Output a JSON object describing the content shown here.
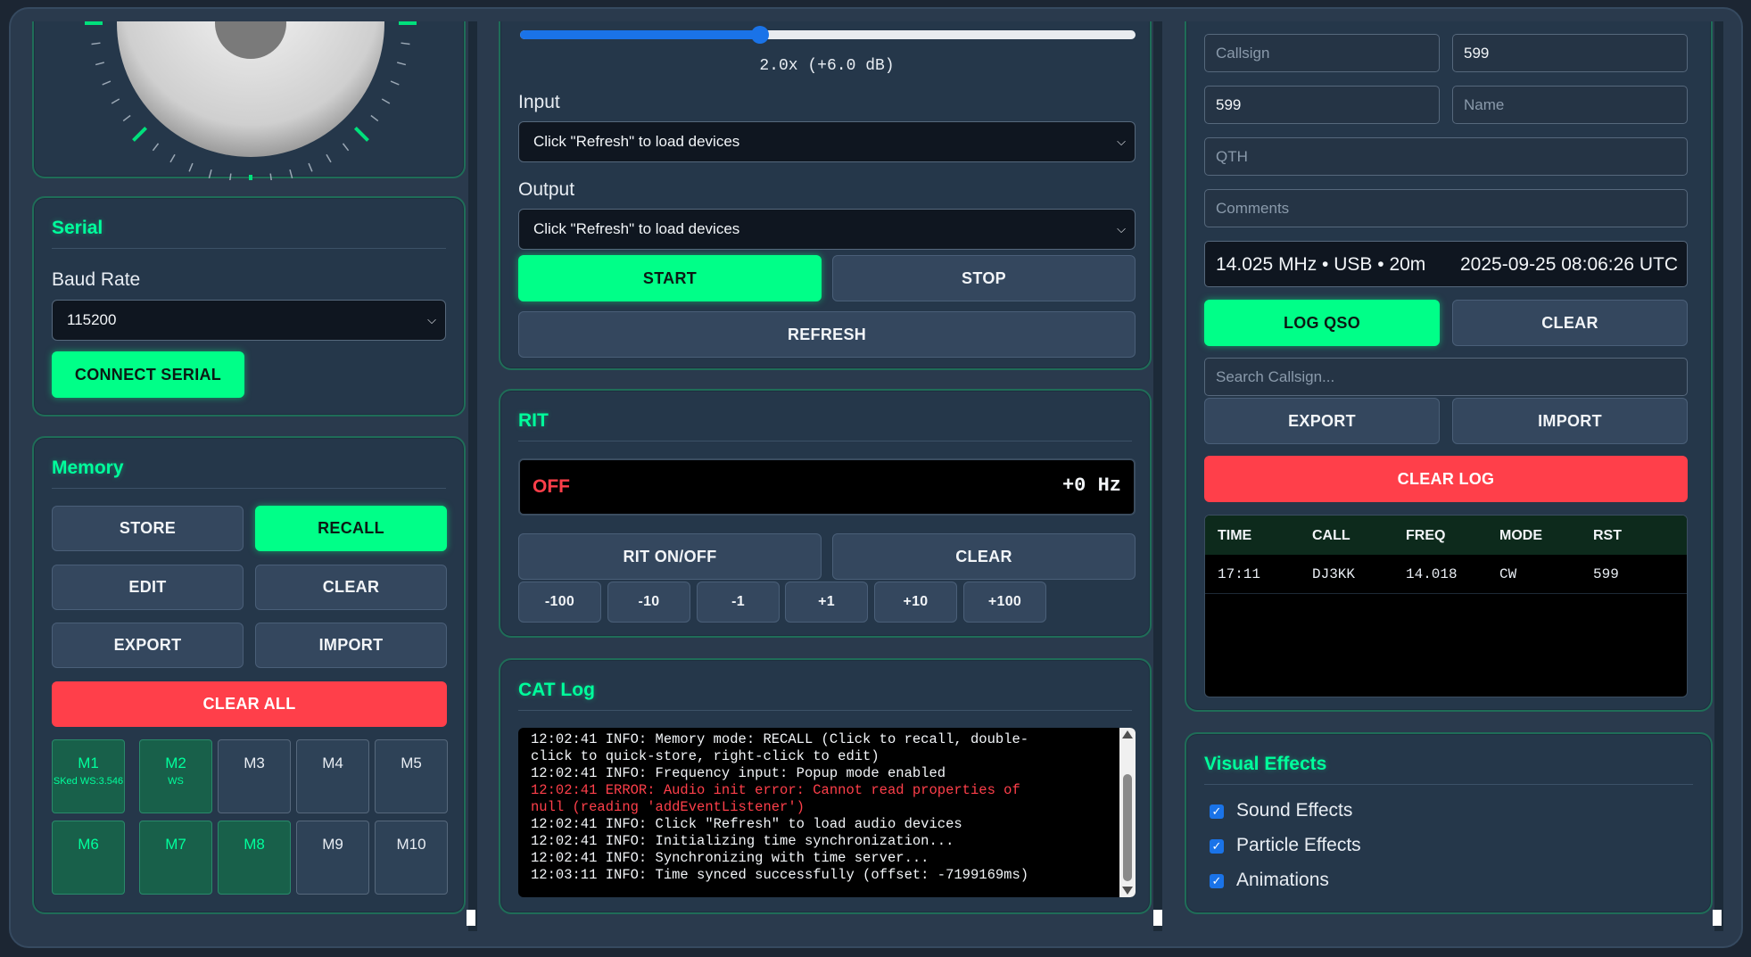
{
  "left": {
    "serial": {
      "title": "Serial",
      "baud_label": "Baud Rate",
      "baud_value": "115200",
      "connect_label": "CONNECT SERIAL"
    },
    "memory": {
      "title": "Memory",
      "store": "STORE",
      "recall": "RECALL",
      "edit": "EDIT",
      "clear": "CLEAR",
      "export": "EXPORT",
      "import": "IMPORT",
      "clear_all": "CLEAR ALL",
      "slots": [
        {
          "name": "M1",
          "desc": "SKed WS:3.546",
          "filled": true
        },
        {
          "name": "M2",
          "desc": "WS",
          "filled": true
        },
        {
          "name": "M3",
          "desc": "",
          "filled": false
        },
        {
          "name": "M4",
          "desc": "",
          "filled": false
        },
        {
          "name": "M5",
          "desc": "",
          "filled": false
        },
        {
          "name": "M6",
          "desc": "",
          "filled": true
        },
        {
          "name": "M7",
          "desc": "",
          "filled": true
        },
        {
          "name": "M8",
          "desc": "",
          "filled": true
        },
        {
          "name": "M9",
          "desc": "",
          "filled": false
        },
        {
          "name": "M10",
          "desc": "",
          "filled": false
        }
      ]
    }
  },
  "mid": {
    "audio": {
      "gain_text": "2.0x (+6.0 dB)",
      "gain_fraction": 0.39,
      "input_label": "Input",
      "input_value": "Click \"Refresh\" to load devices",
      "output_label": "Output",
      "output_value": "Click \"Refresh\" to load devices",
      "start": "START",
      "stop": "STOP",
      "refresh": "REFRESH"
    },
    "rit": {
      "title": "RIT",
      "state": "OFF",
      "offset": "+0 Hz",
      "toggle": "RIT ON/OFF",
      "clear": "CLEAR",
      "steps": [
        "-100",
        "-10",
        "-1",
        "+1",
        "+10",
        "+100"
      ]
    },
    "cat_log": {
      "title": "CAT Log",
      "lines": [
        {
          "text": "12:02:41 INFO: Memory mode: RECALL (Click to recall, double-",
          "error": false
        },
        {
          "text": "click to quick-store, right-click to edit)",
          "error": false
        },
        {
          "text": "12:02:41 INFO: Frequency input: Popup mode enabled",
          "error": false
        },
        {
          "text": "12:02:41 ERROR: Audio init error: Cannot read properties of",
          "error": true
        },
        {
          "text": "null (reading 'addEventListener')",
          "error": true
        },
        {
          "text": "12:02:41 INFO: Click \"Refresh\" to load audio devices",
          "error": false
        },
        {
          "text": "12:02:41 INFO: Initializing time synchronization...",
          "error": false
        },
        {
          "text": "12:02:41 INFO: Synchronizing with time server...",
          "error": false
        },
        {
          "text": "12:03:11 INFO: Time synced successfully (offset: -7199169ms)",
          "error": false
        }
      ]
    }
  },
  "right": {
    "logbook": {
      "callsign_ph": "Callsign",
      "rst_sent": "599",
      "rst_rcvd": "599",
      "name_ph": "Name",
      "qth_ph": "QTH",
      "comments_ph": "Comments",
      "status_freq": "14.025 MHz • USB • 20m",
      "status_time": "2025-09-25 08:06:26 UTC",
      "log_qso": "LOG QSO",
      "clear": "CLEAR",
      "search_ph": "Search Callsign...",
      "export": "EXPORT",
      "import": "IMPORT",
      "clear_log": "CLEAR LOG",
      "columns": [
        "TIME",
        "CALL",
        "FREQ",
        "MODE",
        "RST"
      ],
      "rows": [
        [
          "17:11",
          "DJ3KK",
          "14.018",
          "CW",
          "599"
        ]
      ]
    },
    "visual": {
      "title": "Visual Effects",
      "options": [
        {
          "label": "Sound Effects",
          "checked": true
        },
        {
          "label": "Particle Effects",
          "checked": true
        },
        {
          "label": "Animations",
          "checked": true
        }
      ]
    }
  },
  "colors": {
    "accent": "#00ff88",
    "danger": "#ff3f4a",
    "panel_border": "#1f6d58"
  }
}
